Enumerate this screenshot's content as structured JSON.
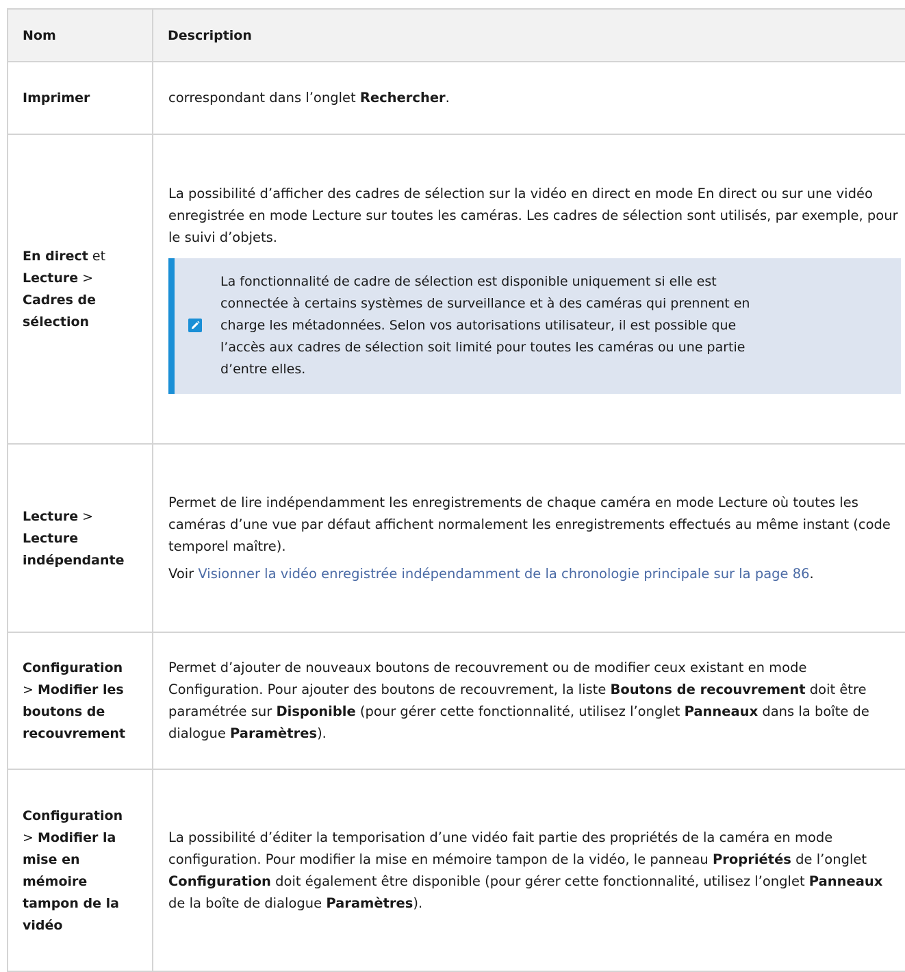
{
  "table": {
    "headers": {
      "name": "Nom",
      "description": "Description"
    },
    "print": {
      "name": "Imprimer",
      "desc_prefix": "correspondant dans l’onglet ",
      "desc_bold": "Rechercher",
      "desc_end": "."
    },
    "bounding_boxes": {
      "name_part1": "En direct",
      "name_join": " et ",
      "name_part2": "Lecture",
      "name_sep": " > ",
      "name_part3": "Cadres de sélection",
      "desc": "La possibilité d’afficher des cadres de sélection sur la vidéo en direct en mode En direct ou sur une vidéo enregistrée en mode Lecture sur toutes les caméras. Les cadres de sélection sont utilisés, par exemple, pour le suivi d’objets.",
      "note": "La fonctionnalité de cadre de sélection est disponible uniquement si elle est connectée à certains systèmes de surveillance et à des caméras qui prennent en charge les métadonnées. Selon vos autorisations utilisateur, il est possible que l’accès aux cadres de sélection soit limité pour toutes les caméras ou une partie d’entre elles.",
      "note_icon": "pencil-icon"
    },
    "independent_playback": {
      "name_part1": "Lecture",
      "name_sep": " > ",
      "name_part2": "Lecture indépendante",
      "desc": "Permet de lire indépendamment les enregistrements de chaque caméra en mode Lecture où toutes les caméras d’une vue par défaut affichent normalement les enregistrements effectués au même instant (code temporel maître).",
      "see_prefix": "Voir ",
      "link": "Visionner la vidéo enregistrée indépendamment de la chronologie principale sur la page 86",
      "see_end": "."
    },
    "overlay_buttons": {
      "name_part1": "Configuration",
      "name_sep": " > ",
      "name_part2": "Modifier les boutons de recouvrement",
      "d1": "Permet d’ajouter de nouveaux boutons de recouvrement ou de modifier ceux existant en mode Configuration. Pour ajouter des boutons de recouvrement, la liste ",
      "b1": "Boutons de recouvrement",
      "d2": " doit être paramétrée sur ",
      "b2": "Disponible",
      "d3": " (pour gérer cette fonctionnalité, utilisez l’onglet ",
      "b3": "Panneaux",
      "d4": " dans la boîte de dialogue ",
      "b4": "Paramètres",
      "d5": ")."
    },
    "video_buffer": {
      "name_part1": "Configuration",
      "name_sep": " > ",
      "name_part2": "Modifier la mise en mémoire tampon de la vidéo",
      "d1": "La possibilité d’éditer la temporisation d’une vidéo fait partie des propriétés de la caméra en mode configuration. Pour modifier la mise en mémoire tampon de la vidéo, le panneau ",
      "b1": "Propriétés",
      "d2": " de l’onglet ",
      "b2": "Configuration",
      "d3": " doit également être disponible (pour gérer cette fonctionnalité, utilisez l’onglet ",
      "b3": "Panneaux",
      "d4": " de la boîte de dialogue ",
      "b4": "Paramètres",
      "d5": ")."
    }
  },
  "colors": {
    "note_bg": "#dde4f0",
    "note_bar": "#1a8fd6",
    "link": "#4a6aa5",
    "header_bg": "#f2f2f2",
    "border": "#d4d4d4"
  }
}
